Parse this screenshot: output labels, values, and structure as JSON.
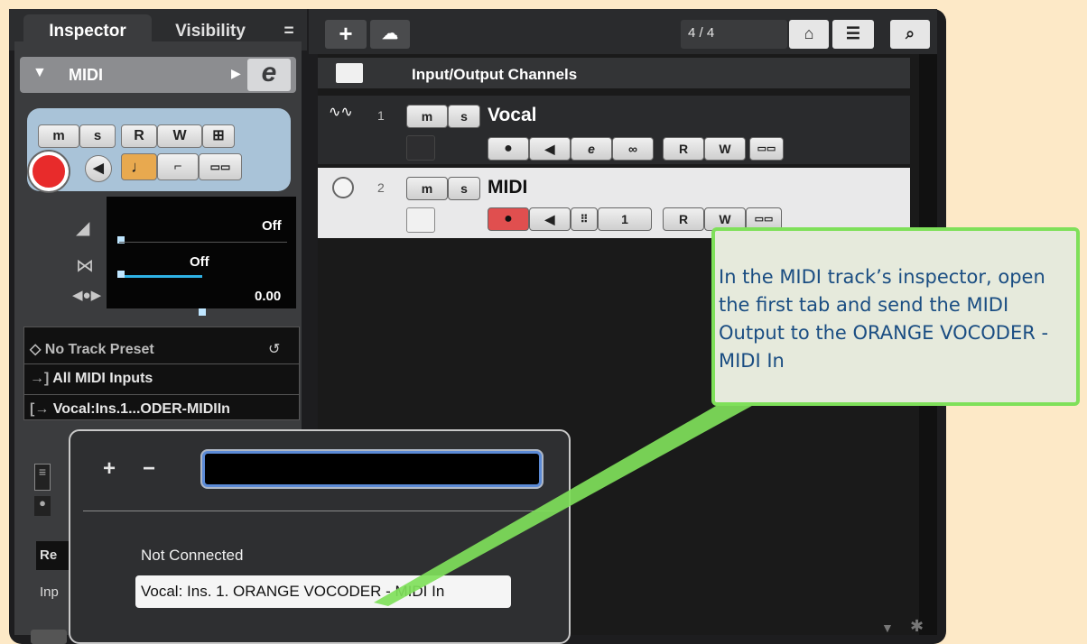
{
  "inspector": {
    "tabs": [
      "Inspector",
      "Visibility",
      "="
    ],
    "track_name": "MIDI",
    "buttons": {
      "m": "m",
      "s": "s",
      "r": "R",
      "w": "W"
    },
    "faders": [
      {
        "value": "Off"
      },
      {
        "value": "Off"
      },
      {
        "value": "0.00"
      }
    ],
    "preset": "No Track Preset",
    "midi_input": "All MIDI Inputs",
    "midi_output": "Vocal:Ins.1...ODER-MIDIIn",
    "partial_labels": [
      "Re",
      "Inp"
    ]
  },
  "toolbar": {
    "add": "+",
    "counter": "4 / 4"
  },
  "tracks": {
    "header": "Input/Output Channels",
    "items": [
      {
        "number": "1",
        "name": "Vocal"
      },
      {
        "number": "2",
        "name": "MIDI",
        "channel": "1"
      }
    ]
  },
  "popup": {
    "plus": "+",
    "minus": "−",
    "options": [
      "Not Connected",
      "Vocal: Ins. 1. ORANGE VOCODER - MIDI In"
    ]
  },
  "callout": {
    "text": "In the MIDI track’s inspector, open the first tab and send the MIDI Output to the ORANGE VOCODER -MIDI In"
  },
  "colors": {
    "accent_green": "#7fe05a",
    "record_red": "#e82b2b",
    "callout_text": "#1a4d82",
    "panel_blue": "#a9c3d8"
  }
}
